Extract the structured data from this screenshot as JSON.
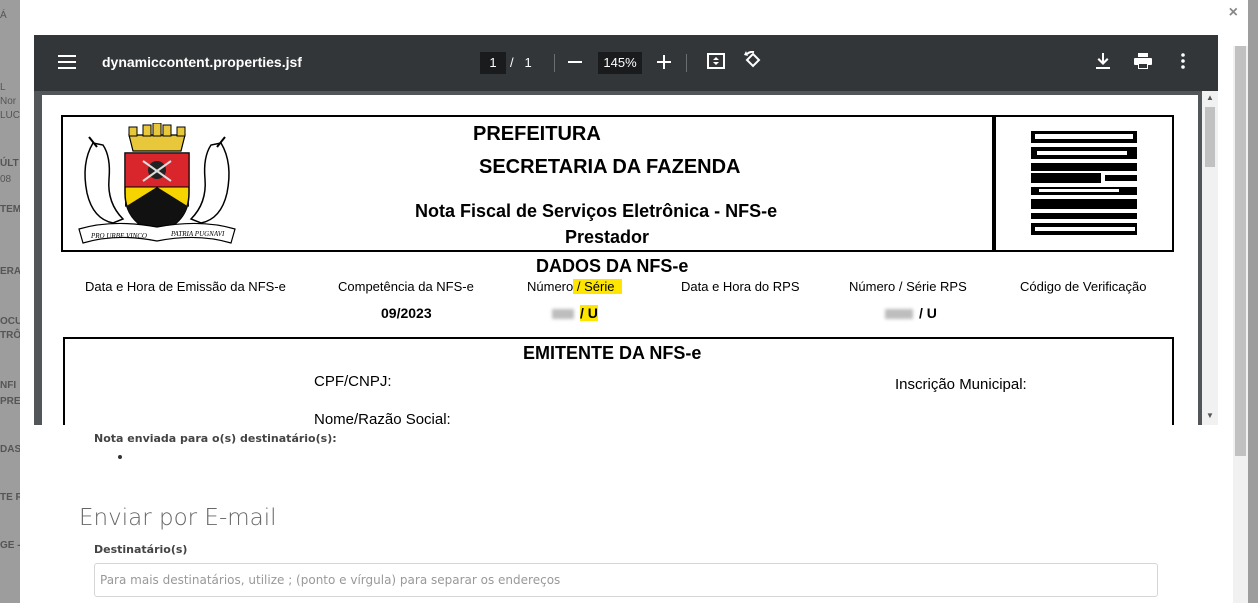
{
  "background": {
    "fragments": [
      "Á",
      "L",
      "Nor",
      "LUC",
      "ÚLT",
      "08",
      "TEM",
      "ERA",
      "OCU",
      "TRÔ",
      "NFI",
      "PRE",
      "DAS",
      "TE R",
      "GE -"
    ]
  },
  "modal": {
    "close_label": "×"
  },
  "viewer": {
    "file_name": "dynamiccontent.properties.jsf",
    "current_page": "1",
    "page_separator": "/",
    "total_pages": "1",
    "zoom_value": "145%",
    "icons": {
      "menu": "menu-icon",
      "zoom_out": "minus-icon",
      "zoom_in": "plus-icon",
      "fit": "fit-page-icon",
      "rotate": "rotate-icon",
      "download": "download-icon",
      "print": "print-icon",
      "more": "more-vert-icon"
    }
  },
  "document": {
    "crest_text_left": "PRO URBE VINCO",
    "crest_text_right": "PATRIA PUGNAVI",
    "prefeitura": "PREFEITURA",
    "secretaria": "SECRETARIA DA FAZENDA",
    "nota_title": "Nota Fiscal de Serviços Eletrônica - NFS-e",
    "prestador": "Prestador",
    "dados_title": "DADOS DA NFS-e",
    "columns": {
      "emissao": "Data e Hora de Emissão da NFS-e",
      "competencia": "Competência da NFS-e",
      "numero_prefix": "Número",
      "numero_highlight": " / Série",
      "data_rps": "Data e Hora do RPS",
      "numero_rps": "Número / Série RPS",
      "codigo": "Código de Verificação"
    },
    "values": {
      "competencia": "09/2023",
      "numero_serie": "/ U",
      "rps_serie": "/ U"
    },
    "emitente_title": "EMITENTE DA NFS-e",
    "cpf_label": "CPF/CNPJ:",
    "inscricao_label": "Inscrição Municipal:",
    "nome_label": "Nome/Razão Social:"
  },
  "form": {
    "sent_label": "Nota enviada para o(s) destinatário(s):",
    "email_title": "Enviar por E-mail",
    "dest_label": "Destinatário(s)",
    "dest_placeholder": "Para mais destinatários, utilize ; (ponto e vírgula) para separar os endereços",
    "dest_value": ""
  }
}
